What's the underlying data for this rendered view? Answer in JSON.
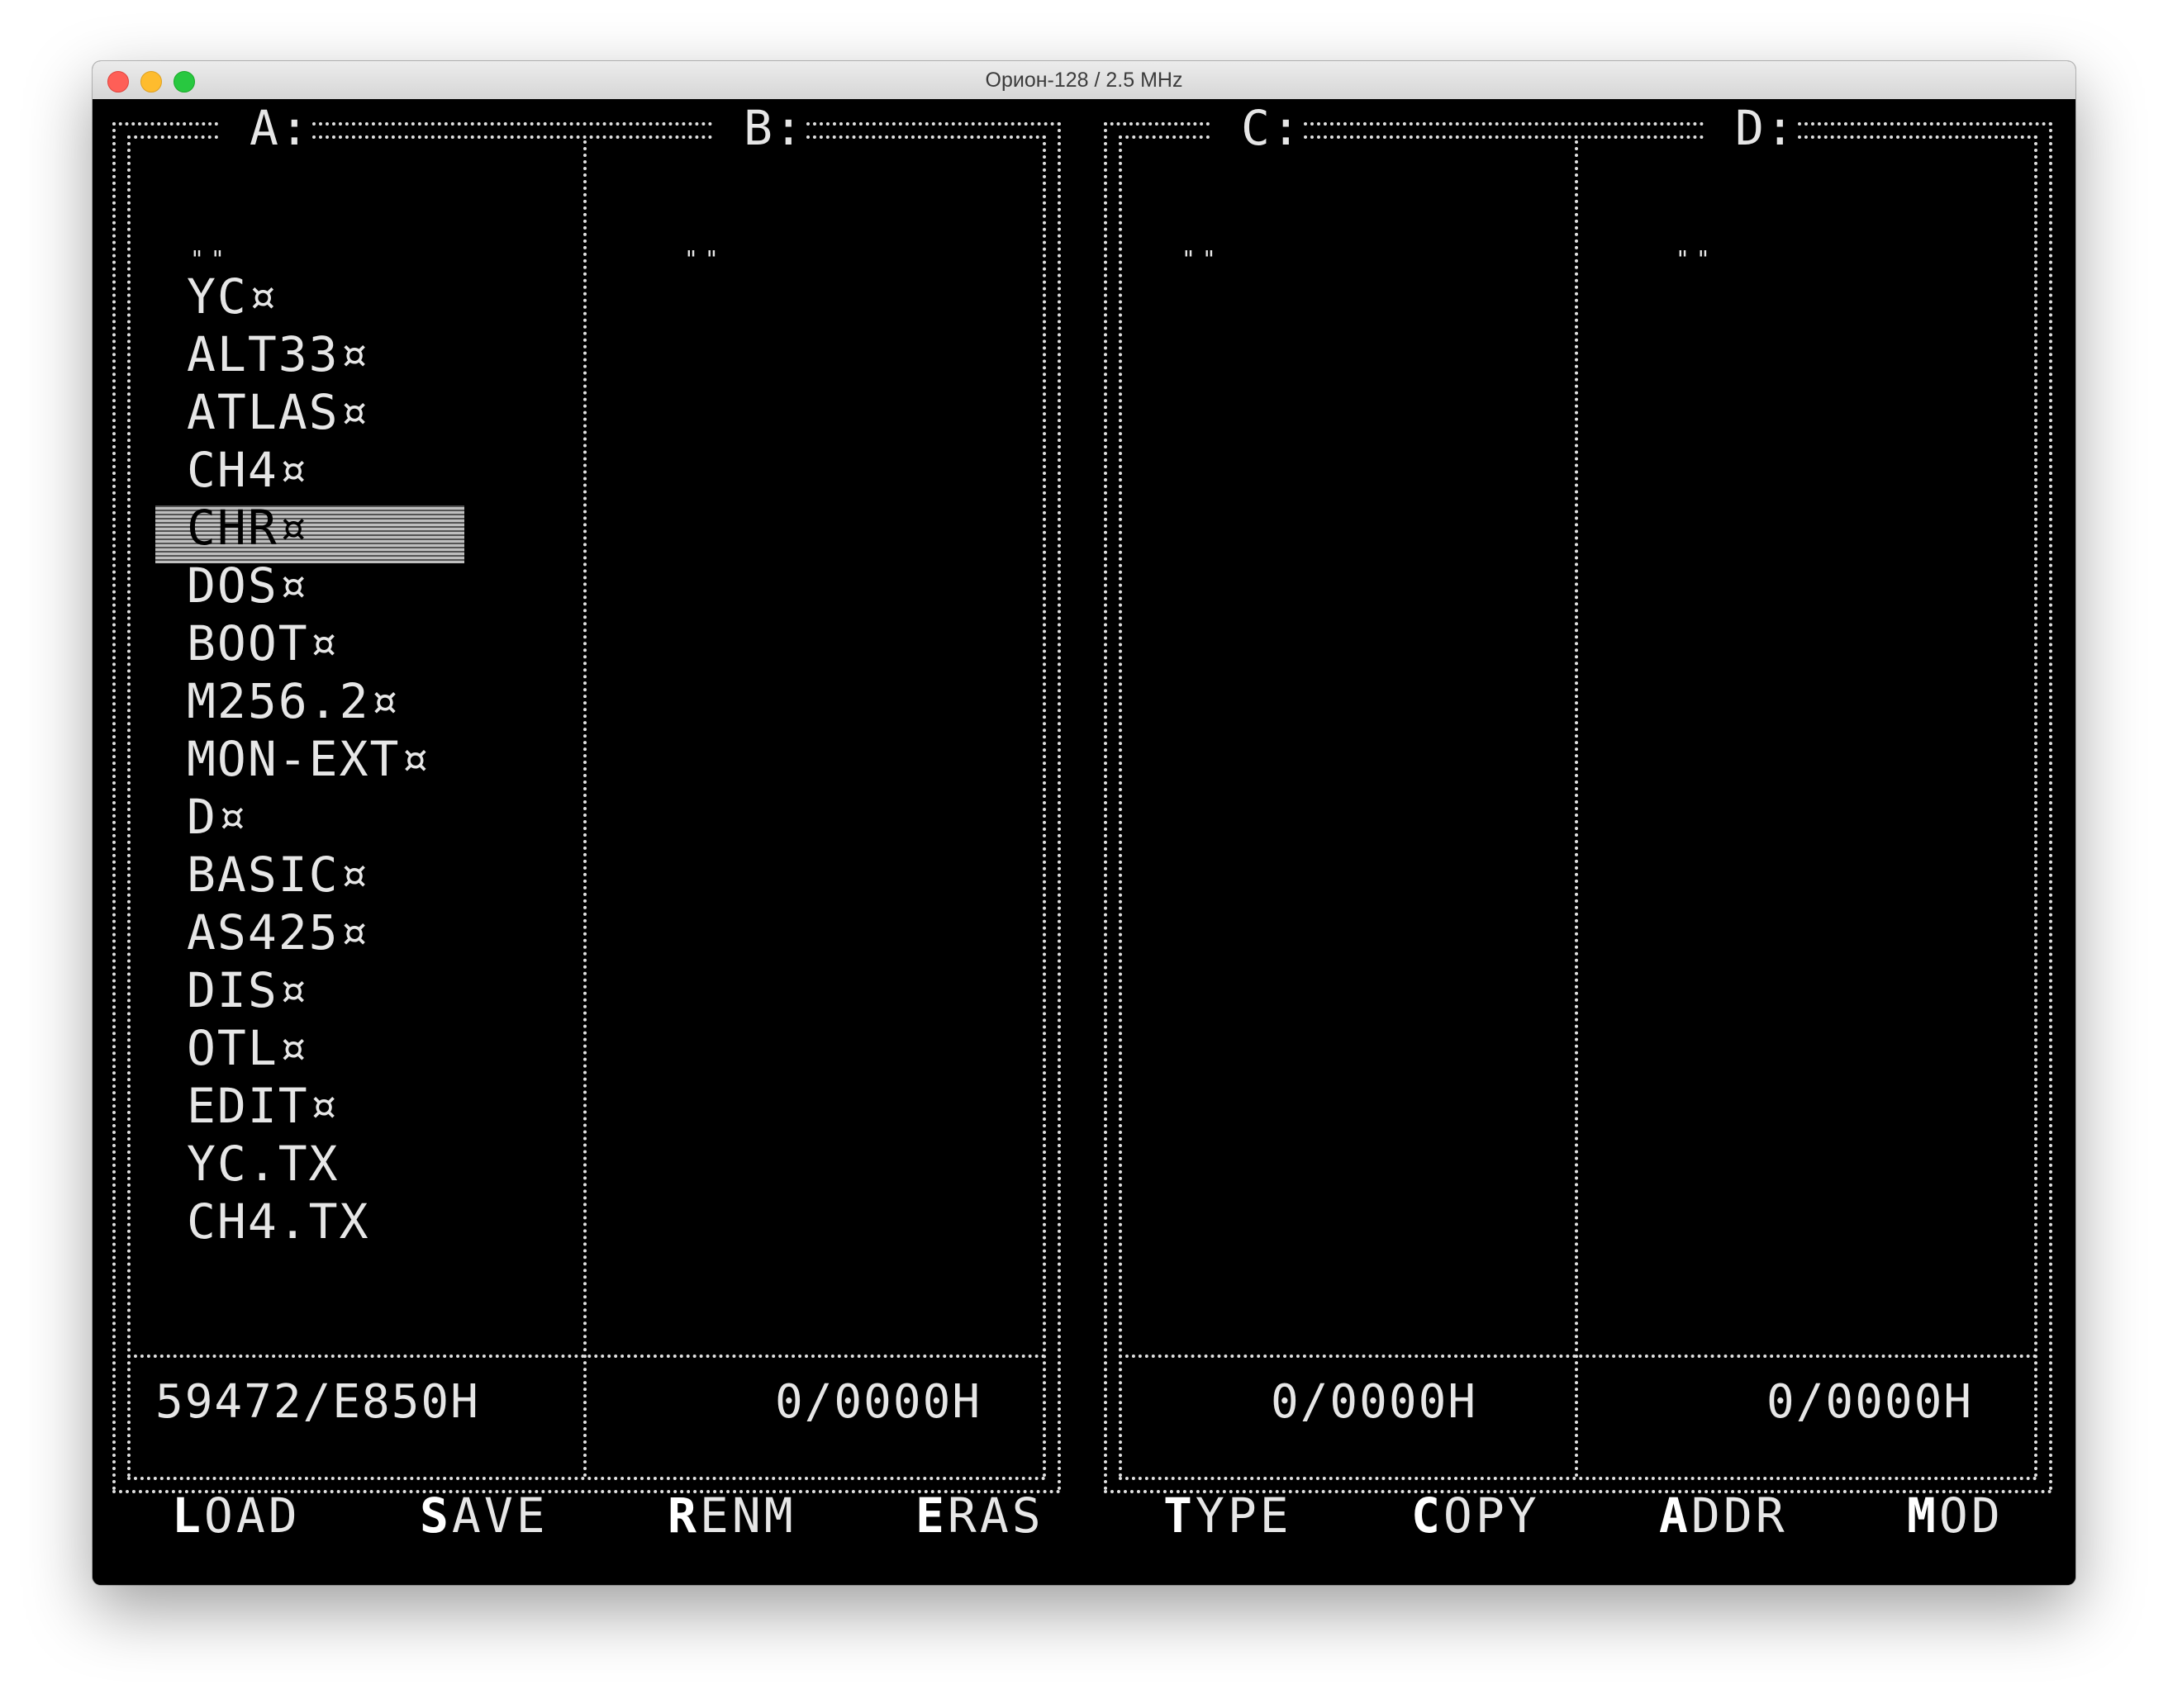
{
  "window": {
    "title": "Орион-128 / 2.5 MHz"
  },
  "panels": {
    "left": {
      "drives": [
        "A:",
        "B:"
      ],
      "updir": {
        "A": "\"\"",
        "B": "\"\""
      },
      "files": [
        "YC¤",
        "ALT33¤",
        "ATLAS¤",
        "CH4¤",
        "CHR¤",
        "DOS¤",
        "BOOT¤",
        "M256.2¤",
        "MON-EXT¤",
        "D¤",
        "BASIC¤",
        "AS425¤",
        "DIS¤",
        "OTL¤",
        "EDIT¤",
        "YC.TX",
        "CH4.TX"
      ],
      "selected_file": "CHR¤",
      "status": {
        "A": "59472/E850H",
        "B": "0/0000H"
      }
    },
    "right": {
      "drives": [
        "C:",
        "D:"
      ],
      "updir": {
        "C": "\"\"",
        "D": "\"\""
      },
      "status": {
        "C": "0/0000H",
        "D": "0/0000H"
      }
    }
  },
  "menu": [
    {
      "hot": "L",
      "rest": "OAD"
    },
    {
      "hot": "S",
      "rest": "AVE"
    },
    {
      "hot": "R",
      "rest": "ENM"
    },
    {
      "hot": "E",
      "rest": "RAS"
    },
    {
      "hot": "T",
      "rest": "YPE"
    },
    {
      "hot": "C",
      "rest": "OPY"
    },
    {
      "hot": "A",
      "rest": "DDR"
    },
    {
      "hot": "M",
      "rest": "OD"
    }
  ],
  "colors": {
    "screen": "#000000",
    "text": "#e6e6e6",
    "cursor": "#cfcfcf"
  }
}
